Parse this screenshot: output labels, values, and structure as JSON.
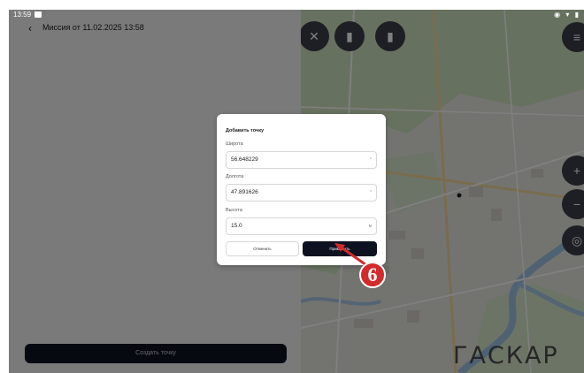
{
  "status": {
    "time": "13:59",
    "right_icons": "◉ ▾ ▮"
  },
  "topbar": {
    "back": "‹",
    "title": "Миссия от 11.02.2025 13:58"
  },
  "left_panel": {
    "create_button": "Создать точку"
  },
  "map": {
    "top_buttons": [
      "✕",
      "▮",
      "▮"
    ],
    "layers_button": "≡",
    "zoom_in": "+",
    "zoom_out": "−",
    "locate": "◎",
    "logo": "ГАСКАР"
  },
  "dialog": {
    "title": "Добавить точку",
    "latitude_label": "Широта",
    "latitude_value": "56.648229",
    "longitude_label": "Долгота",
    "longitude_value": "47.891626",
    "altitude_label": "Высота",
    "altitude_value": "15.0",
    "altitude_unit": "м",
    "cancel": "Отменить",
    "apply": "Применить"
  },
  "callout": {
    "number": "6",
    "color": "#d32b2b"
  }
}
